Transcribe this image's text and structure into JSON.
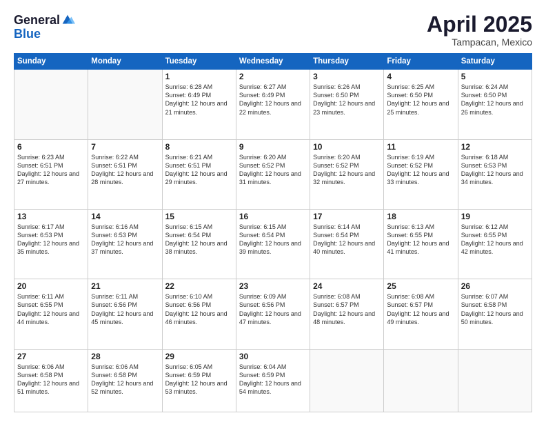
{
  "header": {
    "logo_general": "General",
    "logo_blue": "Blue",
    "title": "April 2025",
    "location": "Tampacan, Mexico"
  },
  "days_of_week": [
    "Sunday",
    "Monday",
    "Tuesday",
    "Wednesday",
    "Thursday",
    "Friday",
    "Saturday"
  ],
  "weeks": [
    [
      {
        "day": "",
        "text": ""
      },
      {
        "day": "",
        "text": ""
      },
      {
        "day": "1",
        "text": "Sunrise: 6:28 AM\nSunset: 6:49 PM\nDaylight: 12 hours and 21 minutes."
      },
      {
        "day": "2",
        "text": "Sunrise: 6:27 AM\nSunset: 6:49 PM\nDaylight: 12 hours and 22 minutes."
      },
      {
        "day": "3",
        "text": "Sunrise: 6:26 AM\nSunset: 6:50 PM\nDaylight: 12 hours and 23 minutes."
      },
      {
        "day": "4",
        "text": "Sunrise: 6:25 AM\nSunset: 6:50 PM\nDaylight: 12 hours and 25 minutes."
      },
      {
        "day": "5",
        "text": "Sunrise: 6:24 AM\nSunset: 6:50 PM\nDaylight: 12 hours and 26 minutes."
      }
    ],
    [
      {
        "day": "6",
        "text": "Sunrise: 6:23 AM\nSunset: 6:51 PM\nDaylight: 12 hours and 27 minutes."
      },
      {
        "day": "7",
        "text": "Sunrise: 6:22 AM\nSunset: 6:51 PM\nDaylight: 12 hours and 28 minutes."
      },
      {
        "day": "8",
        "text": "Sunrise: 6:21 AM\nSunset: 6:51 PM\nDaylight: 12 hours and 29 minutes."
      },
      {
        "day": "9",
        "text": "Sunrise: 6:20 AM\nSunset: 6:52 PM\nDaylight: 12 hours and 31 minutes."
      },
      {
        "day": "10",
        "text": "Sunrise: 6:20 AM\nSunset: 6:52 PM\nDaylight: 12 hours and 32 minutes."
      },
      {
        "day": "11",
        "text": "Sunrise: 6:19 AM\nSunset: 6:52 PM\nDaylight: 12 hours and 33 minutes."
      },
      {
        "day": "12",
        "text": "Sunrise: 6:18 AM\nSunset: 6:53 PM\nDaylight: 12 hours and 34 minutes."
      }
    ],
    [
      {
        "day": "13",
        "text": "Sunrise: 6:17 AM\nSunset: 6:53 PM\nDaylight: 12 hours and 35 minutes."
      },
      {
        "day": "14",
        "text": "Sunrise: 6:16 AM\nSunset: 6:53 PM\nDaylight: 12 hours and 37 minutes."
      },
      {
        "day": "15",
        "text": "Sunrise: 6:15 AM\nSunset: 6:54 PM\nDaylight: 12 hours and 38 minutes."
      },
      {
        "day": "16",
        "text": "Sunrise: 6:15 AM\nSunset: 6:54 PM\nDaylight: 12 hours and 39 minutes."
      },
      {
        "day": "17",
        "text": "Sunrise: 6:14 AM\nSunset: 6:54 PM\nDaylight: 12 hours and 40 minutes."
      },
      {
        "day": "18",
        "text": "Sunrise: 6:13 AM\nSunset: 6:55 PM\nDaylight: 12 hours and 41 minutes."
      },
      {
        "day": "19",
        "text": "Sunrise: 6:12 AM\nSunset: 6:55 PM\nDaylight: 12 hours and 42 minutes."
      }
    ],
    [
      {
        "day": "20",
        "text": "Sunrise: 6:11 AM\nSunset: 6:55 PM\nDaylight: 12 hours and 44 minutes."
      },
      {
        "day": "21",
        "text": "Sunrise: 6:11 AM\nSunset: 6:56 PM\nDaylight: 12 hours and 45 minutes."
      },
      {
        "day": "22",
        "text": "Sunrise: 6:10 AM\nSunset: 6:56 PM\nDaylight: 12 hours and 46 minutes."
      },
      {
        "day": "23",
        "text": "Sunrise: 6:09 AM\nSunset: 6:56 PM\nDaylight: 12 hours and 47 minutes."
      },
      {
        "day": "24",
        "text": "Sunrise: 6:08 AM\nSunset: 6:57 PM\nDaylight: 12 hours and 48 minutes."
      },
      {
        "day": "25",
        "text": "Sunrise: 6:08 AM\nSunset: 6:57 PM\nDaylight: 12 hours and 49 minutes."
      },
      {
        "day": "26",
        "text": "Sunrise: 6:07 AM\nSunset: 6:58 PM\nDaylight: 12 hours and 50 minutes."
      }
    ],
    [
      {
        "day": "27",
        "text": "Sunrise: 6:06 AM\nSunset: 6:58 PM\nDaylight: 12 hours and 51 minutes."
      },
      {
        "day": "28",
        "text": "Sunrise: 6:06 AM\nSunset: 6:58 PM\nDaylight: 12 hours and 52 minutes."
      },
      {
        "day": "29",
        "text": "Sunrise: 6:05 AM\nSunset: 6:59 PM\nDaylight: 12 hours and 53 minutes."
      },
      {
        "day": "30",
        "text": "Sunrise: 6:04 AM\nSunset: 6:59 PM\nDaylight: 12 hours and 54 minutes."
      },
      {
        "day": "",
        "text": ""
      },
      {
        "day": "",
        "text": ""
      },
      {
        "day": "",
        "text": ""
      }
    ]
  ]
}
